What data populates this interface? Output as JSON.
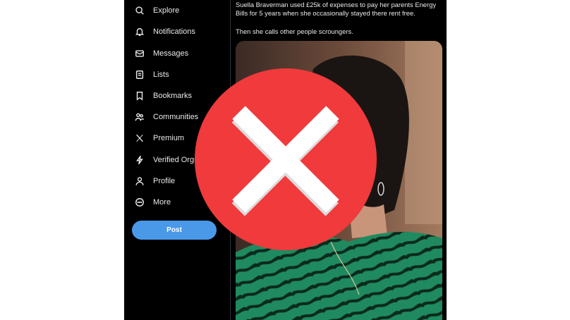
{
  "sidebar": {
    "items": [
      {
        "label": "Explore",
        "icon": "search-icon"
      },
      {
        "label": "Notifications",
        "icon": "bell-icon"
      },
      {
        "label": "Messages",
        "icon": "envelope-icon"
      },
      {
        "label": "Lists",
        "icon": "list-icon"
      },
      {
        "label": "Bookmarks",
        "icon": "bookmark-icon"
      },
      {
        "label": "Communities",
        "icon": "people-icon"
      },
      {
        "label": "Premium",
        "icon": "x-logo-icon"
      },
      {
        "label": "Verified Orgs",
        "icon": "lightning-icon"
      },
      {
        "label": "Profile",
        "icon": "person-icon"
      },
      {
        "label": "More",
        "icon": "more-circle-icon"
      }
    ],
    "post_label": "Post"
  },
  "tweet": {
    "text_line1": "Suella Braverman used £25k of expenses to pay her parents Energy Bills for 5 years when she occasionally stayed there rent free.",
    "text_line2": "Then she calls other people scroungers."
  },
  "overlay": {
    "icon": "red-x-icon",
    "color": "#f03a3c"
  },
  "colors": {
    "background": "#000000",
    "text": "#e7e9ea",
    "accent": "#4a99e9",
    "page": "#ffffff"
  }
}
